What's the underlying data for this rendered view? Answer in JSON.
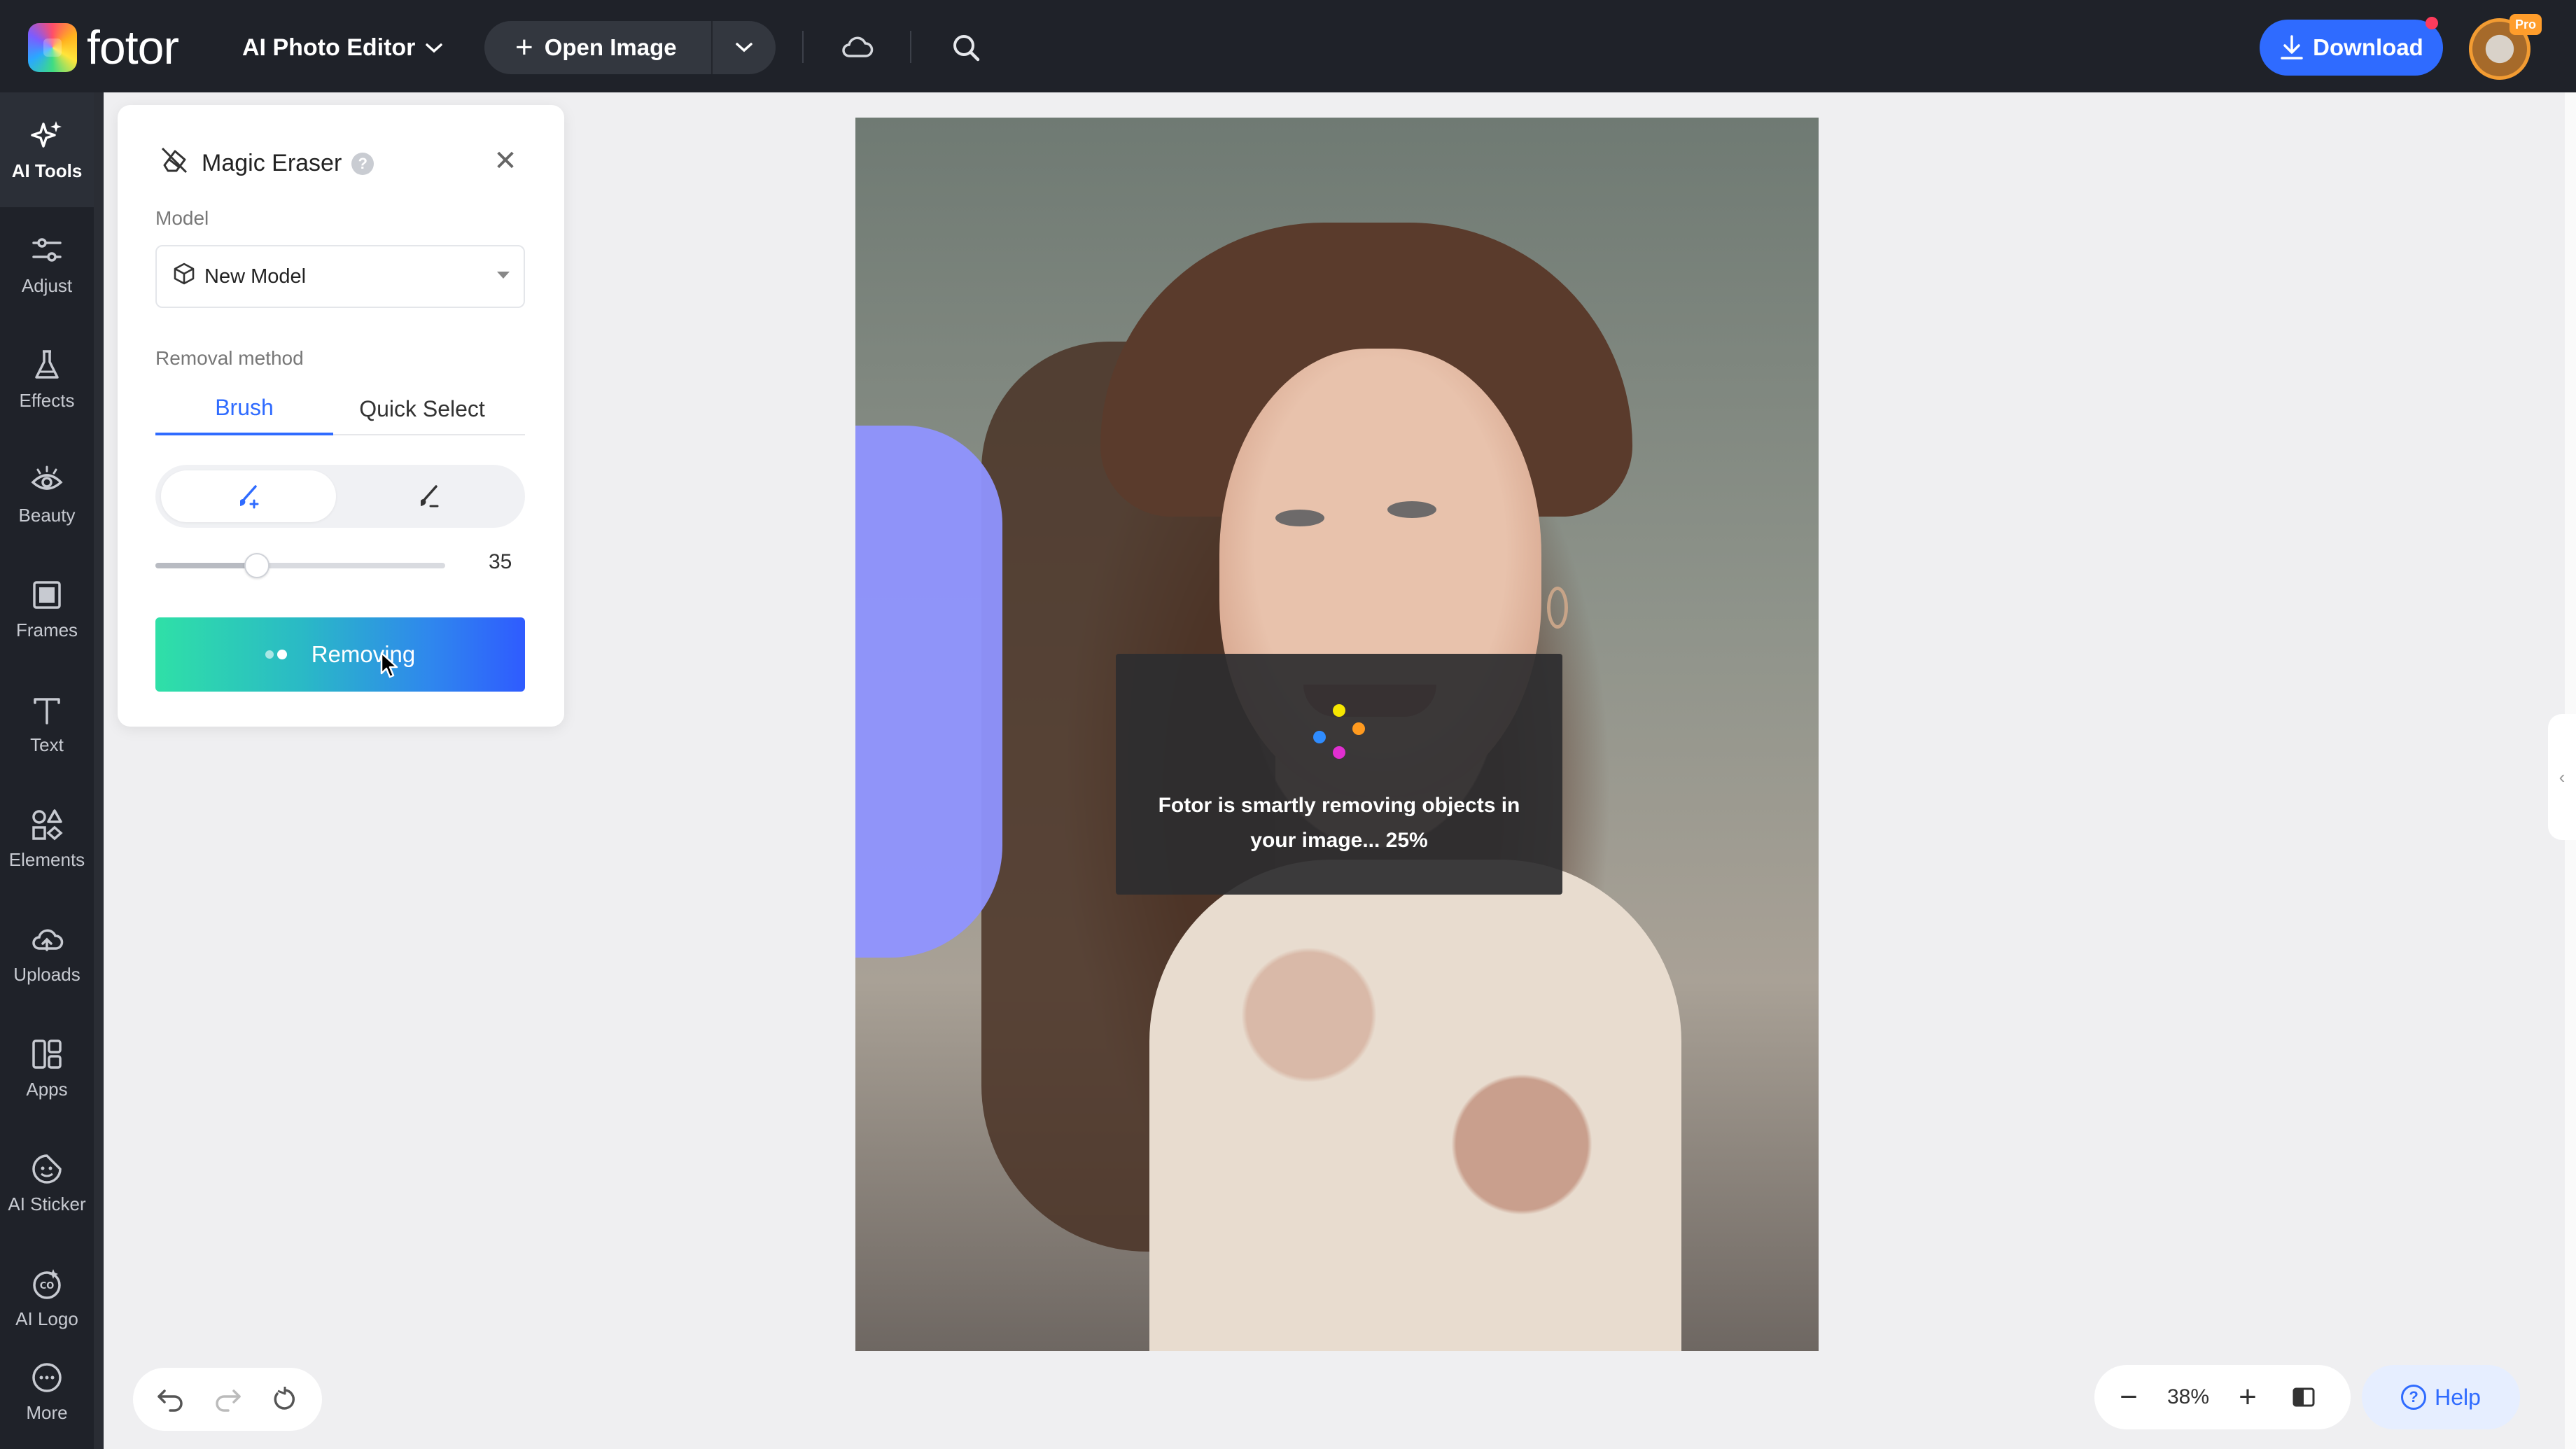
{
  "brand": {
    "name": "fotor"
  },
  "header": {
    "app_switch": "AI Photo Editor",
    "open_image": "Open Image",
    "download": "Download",
    "pro_badge": "Pro",
    "accent": "#2f6bff"
  },
  "nav": {
    "items": [
      {
        "label": "AI Tools",
        "icon": "sparkle-icon",
        "active": true
      },
      {
        "label": "Adjust",
        "icon": "sliders-icon"
      },
      {
        "label": "Effects",
        "icon": "flask-icon"
      },
      {
        "label": "Beauty",
        "icon": "eye-icon"
      },
      {
        "label": "Frames",
        "icon": "frame-icon"
      },
      {
        "label": "Text",
        "icon": "text-icon"
      },
      {
        "label": "Elements",
        "icon": "shapes-icon"
      },
      {
        "label": "Uploads",
        "icon": "cloud-upload-icon"
      },
      {
        "label": "Apps",
        "icon": "apps-icon"
      },
      {
        "label": "AI Sticker",
        "icon": "sticker-icon"
      },
      {
        "label": "AI Logo",
        "icon": "logo-icon"
      },
      {
        "label": "More",
        "icon": "more-icon"
      }
    ]
  },
  "panel": {
    "title": "Magic Eraser",
    "help": "?",
    "close": "✕",
    "model_label": "Model",
    "model_value": "New Model",
    "method_label": "Removal method",
    "tabs": [
      "Brush",
      "Quick Select"
    ],
    "active_tab": "Brush",
    "brush_size": "35",
    "brush_size_fraction": 0.35,
    "action_button": "Removing"
  },
  "modal": {
    "message": "Fotor is smartly removing objects in your image... 25%",
    "progress_percent": 25,
    "spinner_colors": [
      "#f6e600",
      "#ff9a1f",
      "#2f8cff",
      "#e02fd0"
    ]
  },
  "zoom": {
    "value": "38%",
    "minus": "−",
    "plus": "+"
  },
  "help": {
    "label": "Help"
  }
}
